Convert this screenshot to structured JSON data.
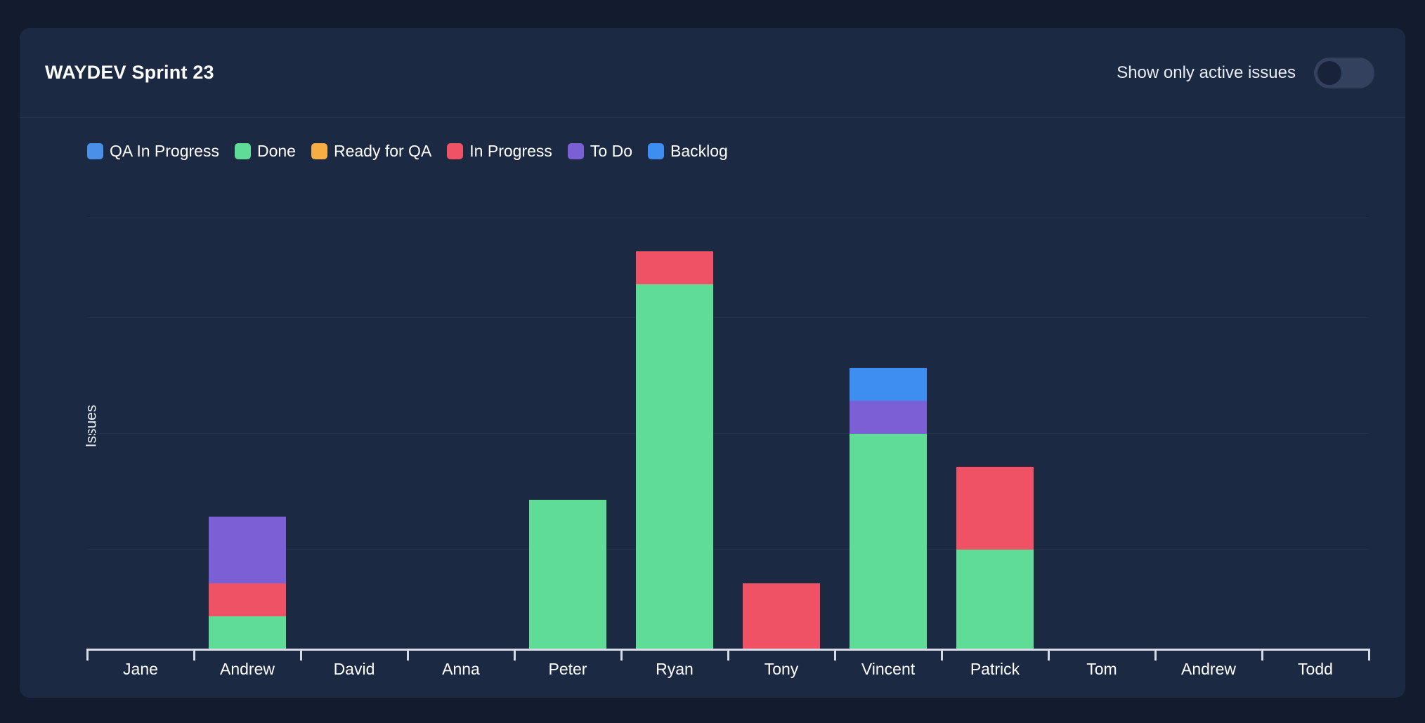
{
  "header": {
    "title": "WAYDEV Sprint 23",
    "toggle_label": "Show only active issues",
    "toggle_state": "off"
  },
  "colors": {
    "page_background": "#131c2e",
    "card_background": "#1b2943",
    "divider": "#243352",
    "gridline": "#24324f",
    "axis": "#d6dbe6",
    "text": "#ffffff",
    "toggle_track": "#33415f",
    "toggle_knob": "#18233a"
  },
  "chart_data": {
    "type": "bar",
    "stacked": true,
    "title": "WAYDEV Sprint 23",
    "xlabel": "",
    "ylabel": "Issues",
    "grid": true,
    "legend_position": "top-left",
    "ylim": [
      0,
      13
    ],
    "gridline_values": [
      3,
      6.5,
      10,
      13
    ],
    "categories": [
      "Jane",
      "Andrew",
      "David",
      "Anna",
      "Peter",
      "Ryan",
      "Tony",
      "Vincent",
      "Patrick",
      "Tom",
      "Andrew",
      "Todd"
    ],
    "series": [
      {
        "name": "QA In Progress",
        "color": "#4a90e8",
        "values": [
          0,
          0,
          0,
          0,
          0,
          0,
          0,
          0,
          0,
          0,
          0,
          0
        ]
      },
      {
        "name": "Done",
        "color": "#5fdd97",
        "values": [
          0,
          1,
          0,
          0,
          4.5,
          11,
          0,
          6.5,
          3,
          0,
          0,
          0
        ]
      },
      {
        "name": "Ready for QA",
        "color": "#f5ad44",
        "values": [
          0,
          0,
          0,
          0,
          0,
          0,
          0,
          0,
          0,
          0,
          0,
          0
        ]
      },
      {
        "name": "In Progress",
        "color": "#ef5264",
        "values": [
          0,
          1,
          0,
          0,
          0,
          1,
          2,
          0,
          2.5,
          0,
          0,
          0
        ]
      },
      {
        "name": "To Do",
        "color": "#7b5fd4",
        "values": [
          0,
          2,
          0,
          0,
          0,
          0,
          0,
          1,
          0,
          0,
          0,
          0
        ]
      },
      {
        "name": "Backlog",
        "color": "#3d8ef0",
        "values": [
          0,
          0,
          0,
          0,
          0,
          0,
          0,
          1,
          0,
          0,
          0,
          0
        ]
      }
    ]
  },
  "legend": [
    {
      "label": "QA In Progress",
      "color": "#4a90e8"
    },
    {
      "label": "Done",
      "color": "#5fdd97"
    },
    {
      "label": "Ready for QA",
      "color": "#f5ad44"
    },
    {
      "label": "In Progress",
      "color": "#ef5264"
    },
    {
      "label": "To Do",
      "color": "#7b5fd4"
    },
    {
      "label": "Backlog",
      "color": "#3d8ef0"
    }
  ]
}
